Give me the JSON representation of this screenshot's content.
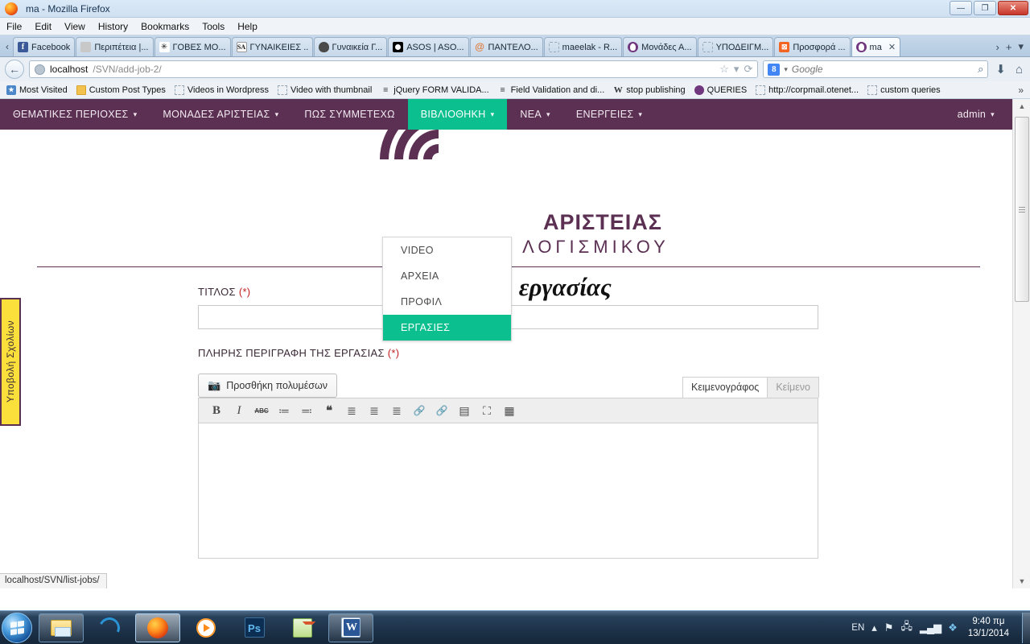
{
  "window": {
    "title": "ma - Mozilla Firefox",
    "buttons": {
      "minimize": "—",
      "maximize": "❐",
      "close": "✕"
    }
  },
  "menubar": [
    {
      "label": "File"
    },
    {
      "label": "Edit"
    },
    {
      "label": "View"
    },
    {
      "label": "History"
    },
    {
      "label": "Bookmarks"
    },
    {
      "label": "Tools"
    },
    {
      "label": "Help"
    }
  ],
  "tabs": [
    {
      "label": "Facebook",
      "icon": "facebook-favicon",
      "active": false
    },
    {
      "label": "Περιπέτεια |...",
      "icon": "generic-favicon",
      "active": false
    },
    {
      "label": "ΓΟΒΕΣ ΜΟ...",
      "icon": "spider-favicon",
      "active": false
    },
    {
      "label": "ΓΥΝΑΙΚΕΙΕΣ ...",
      "icon": "sa-favicon",
      "active": false
    },
    {
      "label": "Γυναικεία Γ...",
      "icon": "dark-favicon",
      "active": false
    },
    {
      "label": "ASOS | ASO...",
      "icon": "asos-favicon",
      "active": false
    },
    {
      "label": "ΠΑΝΤΕΛΟ...",
      "icon": "at-favicon",
      "active": false
    },
    {
      "label": "maeelak - R...",
      "icon": "placeholder-favicon",
      "active": false
    },
    {
      "label": "Μονάδες Α...",
      "icon": "wordpress-favicon",
      "active": false
    },
    {
      "label": "ΥΠΟΔΕΙΓΜ...",
      "icon": "placeholder-favicon",
      "active": false
    },
    {
      "label": "Προσφορά ...",
      "icon": "orange-favicon",
      "active": false
    },
    {
      "label": "ma",
      "icon": "wordpress-favicon",
      "active": true,
      "close": "✕"
    }
  ],
  "tabstrip": {
    "scroll_left": "‹",
    "scroll_right": "›",
    "new_tab": "+",
    "list_all": "▾"
  },
  "urlbar": {
    "back": "←",
    "host": "localhost",
    "path": "/SVN/add-job-2/",
    "bookmark_star": "☆",
    "dropmarker": "▾",
    "reload": "⟳"
  },
  "searchbar": {
    "engine": "8",
    "engine_caret": "▾",
    "placeholder": "Google",
    "magnifier": "⌕"
  },
  "navicons": {
    "download": "⬇",
    "home": "⌂"
  },
  "bookmarks": [
    {
      "label": "Most Visited",
      "icon": "blue-favicon"
    },
    {
      "label": "Custom Post Types",
      "icon": "folder-icon"
    },
    {
      "label": "Videos in Wordpress",
      "icon": "placeholder-favicon"
    },
    {
      "label": "Video with thumbnail",
      "icon": "placeholder-favicon"
    },
    {
      "label": "jQuery FORM VALIDA...",
      "icon": "script-favicon"
    },
    {
      "label": "Field Validation and di...",
      "icon": "script-favicon"
    },
    {
      "label": "stop publishing",
      "icon": "w-favicon"
    },
    {
      "label": "QUERIES",
      "icon": "wordpress-favicon"
    },
    {
      "label": "http://corpmail.otenet...",
      "icon": "placeholder-favicon"
    },
    {
      "label": "custom queries",
      "icon": "placeholder-favicon"
    }
  ],
  "bookmarks_overflow": "»",
  "sitenav": {
    "items": [
      {
        "label": "ΘΕΜΑΤΙΚΕΣ ΠΕΡΙΟΧΕΣ",
        "caret": "▾",
        "active": false
      },
      {
        "label": "ΜΟΝΑΔΕΣ ΑΡΙΣΤΕΙΑΣ",
        "caret": "▾",
        "active": false
      },
      {
        "label": "ΠΩΣ ΣΥΜΜΕΤΕΧΩ",
        "caret": "",
        "active": false
      },
      {
        "label": "ΒΙΒΛΙΟΘΗΚΗ",
        "caret": "▾",
        "active": true
      },
      {
        "label": "ΝΕΑ",
        "caret": "▾",
        "active": false
      },
      {
        "label": "ΕΝΕΡΓΕΙΕΣ",
        "caret": "▾",
        "active": false
      }
    ],
    "user": {
      "label": "admin",
      "caret": "▾"
    }
  },
  "dropdown": {
    "items": [
      {
        "label": "VIDEO",
        "active": false
      },
      {
        "label": "ΑΡΧΕΙΑ",
        "active": false
      },
      {
        "label": "ΠΡΟΦΙΛ",
        "active": false
      },
      {
        "label": "ΕΡΓΑΣΙΕΣ",
        "active": true
      }
    ]
  },
  "logo": {
    "line1": "ΑΡΙΣΤΕΙΑΣ",
    "line2": "ΑΝΟΙΧΤΟΥ ΛΟΓΙΣΜΙΚΟΥ"
  },
  "feedback_tab": {
    "label": "Υποβολή Σχολίων"
  },
  "page": {
    "title": "Προσθήκη εργασίας",
    "title_label": "ΤΙΤΛΟΣ (*)",
    "title_value": "",
    "description_label": "ΠΛΗΡΗΣ ΠΕΡΙΓΡΑΦΗ ΤΗΣ ΕΡΓΑΣΙΑΣ (*)",
    "add_media": "Προσθήκη πολυμέσων",
    "editor_tabs": [
      {
        "label": "Κειμενογράφος",
        "active": true
      },
      {
        "label": "Κείμενο",
        "active": false
      }
    ],
    "editor_body": "",
    "toolbar": [
      {
        "name": "bold-icon",
        "glyph": "B",
        "dim": false
      },
      {
        "name": "italic-icon",
        "glyph": "I",
        "dim": false
      },
      {
        "name": "strikethrough-icon",
        "glyph": "ABC",
        "dim": false
      },
      {
        "name": "bulleted-list-icon",
        "glyph": "≔",
        "dim": false
      },
      {
        "name": "numbered-list-icon",
        "glyph": "≕",
        "dim": false
      },
      {
        "name": "blockquote-icon",
        "glyph": "❝",
        "dim": false
      },
      {
        "name": "align-left-icon",
        "glyph": "≣",
        "dim": false
      },
      {
        "name": "align-center-icon",
        "glyph": "≣",
        "dim": false
      },
      {
        "name": "align-right-icon",
        "glyph": "≣",
        "dim": false
      },
      {
        "name": "insert-link-icon",
        "glyph": "🔗",
        "dim": true
      },
      {
        "name": "remove-link-icon",
        "glyph": "🔗",
        "dim": true
      },
      {
        "name": "read-more-icon",
        "glyph": "▤",
        "dim": false
      },
      {
        "name": "fullscreen-icon",
        "glyph": "⛶",
        "dim": false
      },
      {
        "name": "toolbar-toggle-icon",
        "glyph": "▦",
        "dim": false
      }
    ]
  },
  "scrollbar": {
    "up": "▲",
    "down": "▼"
  },
  "status_link": "localhost/SVN/list-jobs/",
  "taskbar": {
    "buttons": [
      {
        "name": "windows-explorer",
        "icon": "explorer-icon",
        "active": false
      },
      {
        "name": "internet-explorer",
        "icon": "ie-icon",
        "active": false
      },
      {
        "name": "firefox",
        "icon": "firefox-icon",
        "active": true
      },
      {
        "name": "windows-media-player",
        "icon": "wmp-icon",
        "active": false
      },
      {
        "name": "photoshop",
        "icon": "photoshop-icon",
        "active": false
      },
      {
        "name": "notepad-plus-plus",
        "icon": "notepad-icon",
        "active": false
      },
      {
        "name": "microsoft-word",
        "icon": "word-icon",
        "active": false
      }
    ],
    "tray": {
      "language": "EN",
      "show_hidden": "▴",
      "action_center": "⚑",
      "network_alt": "🖧",
      "signal": "▂▄▆",
      "dropbox": "❖",
      "time": "9:40 πμ",
      "date": "13/1/2014"
    }
  },
  "colors": {
    "brand_purple": "#5b3053",
    "brand_green": "#0bbf8f",
    "feedback_yellow": "#fbe03c",
    "required_red": "#c02020"
  }
}
